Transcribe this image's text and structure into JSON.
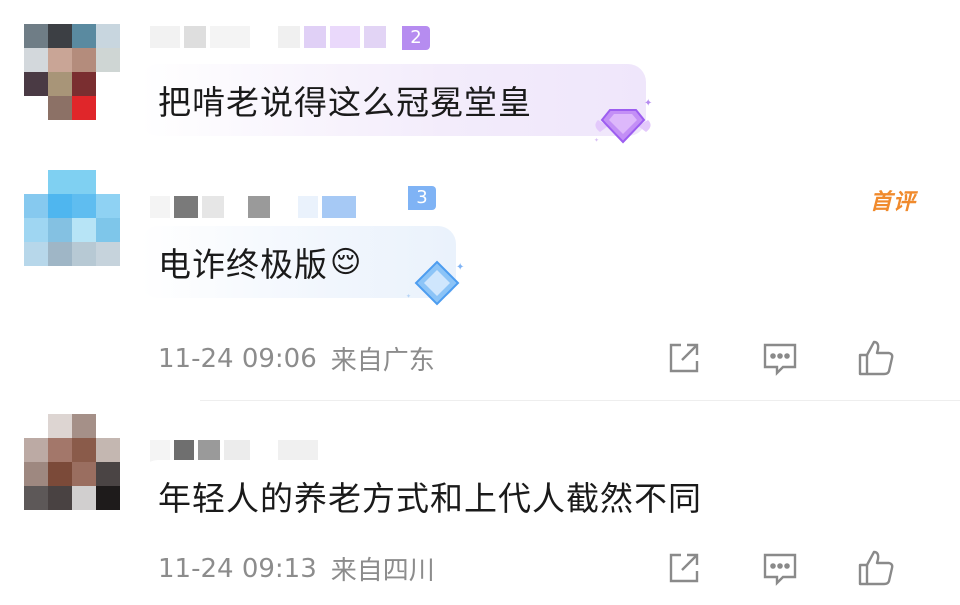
{
  "comments": [
    {
      "text": "把啃老说得这么冠冕堂皇",
      "level": "2",
      "time": "",
      "location": ""
    },
    {
      "text": "电诈终极版",
      "level": "3",
      "badge": "首评",
      "time": "11-24 09:06",
      "location": "来自广东",
      "emoji": "😌"
    },
    {
      "text": "年轻人的养老方式和上代人截然不同",
      "time": "11-24 09:13",
      "location": "来自四川"
    }
  ],
  "icons": {
    "share": "share-icon",
    "reply": "comment-icon",
    "like": "like-icon",
    "gem": "gem-badge-icon"
  },
  "colors": {
    "meta_text": "#8c8c8c",
    "badge_orange": "#f08a2c",
    "bubble_purple": "#f3ecfb",
    "bubble_blue": "#edf4fd"
  }
}
